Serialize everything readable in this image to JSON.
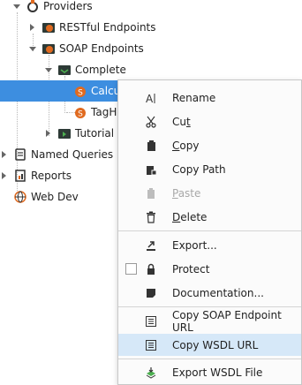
{
  "tree": {
    "items": [
      {
        "label": "Providers"
      },
      {
        "label": "RESTful Endpoints"
      },
      {
        "label": "SOAP Endpoints"
      },
      {
        "label": "Complete"
      },
      {
        "label": "Calcu"
      },
      {
        "label": "TagHi"
      },
      {
        "label": "Tutorial"
      },
      {
        "label": "Named Queries"
      },
      {
        "label": "Reports"
      },
      {
        "label": "Web Dev"
      }
    ]
  },
  "context_menu": {
    "items": [
      {
        "label": "Rename",
        "icon": "rename-icon"
      },
      {
        "label_pre": "Cu",
        "label_u": "t",
        "icon": "scissors-icon"
      },
      {
        "label_u": "C",
        "label_post": "opy",
        "icon": "copy-icon"
      },
      {
        "label": "Copy Path",
        "icon": "copy-path-icon"
      },
      {
        "label_u": "P",
        "label_post": "aste",
        "icon": "paste-icon",
        "disabled": true
      },
      {
        "label_u": "D",
        "label_post": "elete",
        "icon": "trash-icon"
      },
      {
        "label": "Export...",
        "icon": "export-icon"
      },
      {
        "label": "Protect",
        "icon": "lock-icon",
        "checked": false
      },
      {
        "label": "Documentation...",
        "icon": "document-icon"
      },
      {
        "label": "Copy SOAP Endpoint URL",
        "icon": "soap-url-icon"
      },
      {
        "label": "Copy WSDL URL",
        "icon": "wsdl-url-icon",
        "highlighted": true
      },
      {
        "label": "Export WSDL File",
        "icon": "export-file-icon"
      }
    ]
  },
  "colors": {
    "selection": "#3d8ee0",
    "menu_hover": "#d6e8f8",
    "soap_orange": "#e06a1f",
    "folder_dark": "#2d3a36",
    "folder_green": "#4caf50"
  }
}
